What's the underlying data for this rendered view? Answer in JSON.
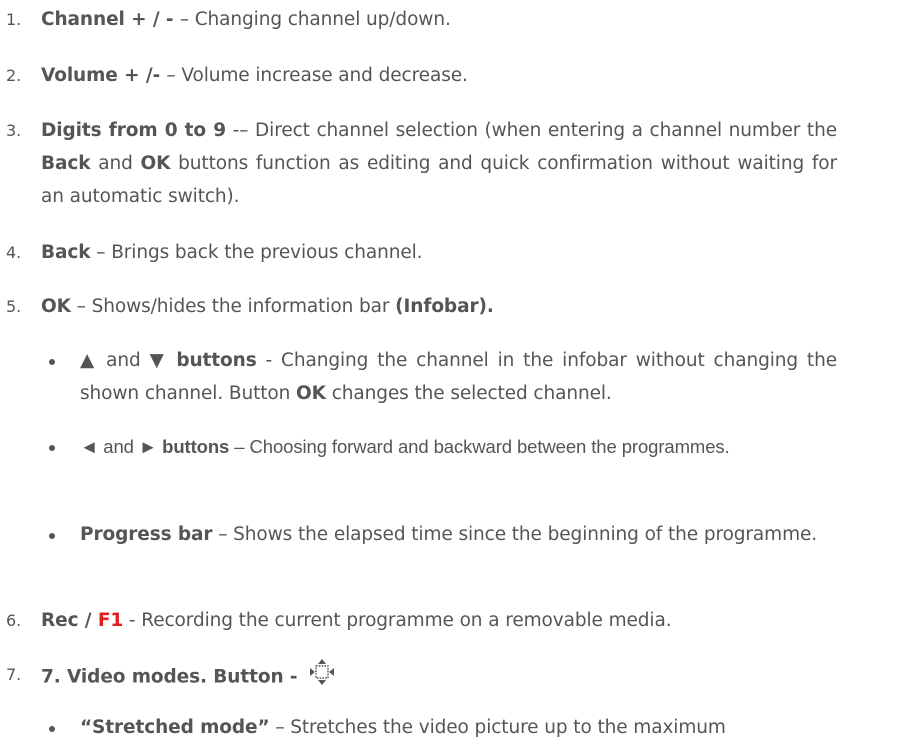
{
  "items": [
    {
      "n": "1.",
      "key": "Channel  + / - ",
      "sep": " – ",
      "desc": "Changing channel up/down."
    },
    {
      "n": "2.",
      "key": "Volume + /- ",
      "sep": " – ",
      "desc": "Volume increase and decrease."
    },
    {
      "n": "3.",
      "key": "Digits from 0 to 9",
      "sep": " -– ",
      "desc_a": "Direct channel selection (when entering a channel number the ",
      "k1": "Back",
      "mid": " and ",
      "k2": "OK",
      "desc_b": " buttons function as editing and quick confirmation without waiting for an automatic switch)."
    },
    {
      "n": "4.",
      "key": "Back",
      "sep": " – ",
      "desc": "Brings back the previous channel."
    },
    {
      "n": "5.",
      "key": "OK",
      "sep": " – ",
      "desc": "Shows/hides the information bar ",
      "tail": "(Infobar)."
    },
    {
      "n": "6.",
      "key": "Rec / ",
      "key_red": "F1",
      "sep": " - ",
      "desc": "Recording the current programme on a removable media."
    },
    {
      "n": "7.",
      "key": "7. Video modes. Button - "
    }
  ],
  "subitems": [
    {
      "k_a": "▲",
      "and": " and ",
      "k_b": "▼ buttons",
      "sep": " - ",
      "desc_a": "Changing the channel in the infobar without changing the shown channel. Button ",
      "k2": "OK",
      "desc_b": " changes the selected channel."
    },
    {
      "k_a": "◄",
      "and": " and ",
      "k_b": "► buttons",
      "sep": " – ",
      "desc": "Choosing forward and backward between the programmes."
    },
    {
      "key": "Progress bar",
      "sep": " – ",
      "desc": "Shows the elapsed time since the beginning of the programme."
    },
    {
      "key": "“Stretched mode”",
      "sep": " – ",
      "desc": "Stretches the video picture up to the maximum"
    }
  ],
  "icons": {
    "video_mode": "video-mode-icon"
  }
}
